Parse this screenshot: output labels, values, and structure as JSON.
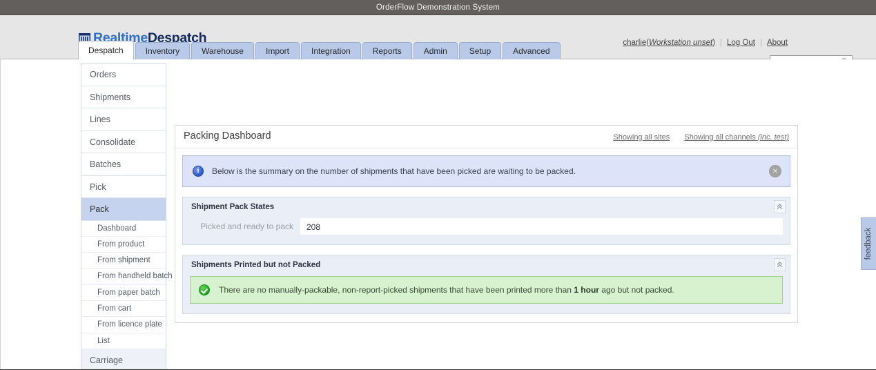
{
  "window": {
    "title": "OrderFlow Demonstration System"
  },
  "brand": {
    "name_part1": "Realtime",
    "name_part2": "Despatch",
    "logo_icon": "warehouse-building-icon",
    "color_part1": "#2f6fc4",
    "color_part2": "#11295c"
  },
  "userbar": {
    "username": "charlie",
    "open_paren": "(",
    "workstation": "Workstation unset",
    "close_paren": ")",
    "logout_label": "Log Out",
    "about_label": "About",
    "divider": "|"
  },
  "search": {
    "value": "",
    "placeholder": "",
    "icon": "magnifying-glass-icon"
  },
  "tabs": [
    {
      "label": "Despatch",
      "active": true
    },
    {
      "label": "Inventory",
      "active": false
    },
    {
      "label": "Warehouse",
      "active": false
    },
    {
      "label": "Import",
      "active": false
    },
    {
      "label": "Integration",
      "active": false
    },
    {
      "label": "Reports",
      "active": false
    },
    {
      "label": "Admin",
      "active": false
    },
    {
      "label": "Setup",
      "active": false
    },
    {
      "label": "Advanced",
      "active": false
    }
  ],
  "sidebar": {
    "items": [
      {
        "label": "Orders"
      },
      {
        "label": "Shipments"
      },
      {
        "label": "Lines"
      },
      {
        "label": "Consolidate"
      },
      {
        "label": "Batches"
      },
      {
        "label": "Pick"
      },
      {
        "label": "Pack"
      }
    ],
    "selected_label": "Pack",
    "subitems": [
      {
        "label": "Dashboard"
      },
      {
        "label": "From product"
      },
      {
        "label": "From shipment"
      },
      {
        "label": "From handheld batch"
      },
      {
        "label": "From paper batch"
      },
      {
        "label": "From cart"
      },
      {
        "label": "From licence plate"
      },
      {
        "label": "List"
      }
    ],
    "tail_item": {
      "label": "Carriage"
    }
  },
  "main": {
    "page_title": "Packing Dashboard",
    "head_links": [
      {
        "label": "Showing all sites"
      }
    ],
    "channels_link": {
      "text": "Showing all channels ",
      "italic": "(inc. test)"
    },
    "info_alert": {
      "icon": "info-circle-icon",
      "message": "Below is the summary on the number of shipments that have been picked are waiting to be packed.",
      "close_icon": "close-circle-icon",
      "bg_color": "#dde3f8"
    },
    "panels": [
      {
        "title": "Shipment Pack States",
        "collapse_icon": "double-chevron-up-icon",
        "field_label": "Picked and ready to pack",
        "field_value": "208"
      },
      {
        "title": "Shipments Printed but not Packed",
        "collapse_icon": "double-chevron-up-icon",
        "success": {
          "icon": "check-circle-icon",
          "text_before": "There are no manually-packable, non-report-picked shipments that have been printed more than ",
          "emphasis": "1 hour",
          "text_after": " ago but not packed.",
          "bg_color": "#d7f2ce"
        }
      }
    ]
  },
  "feedback": {
    "label": "feedback"
  }
}
